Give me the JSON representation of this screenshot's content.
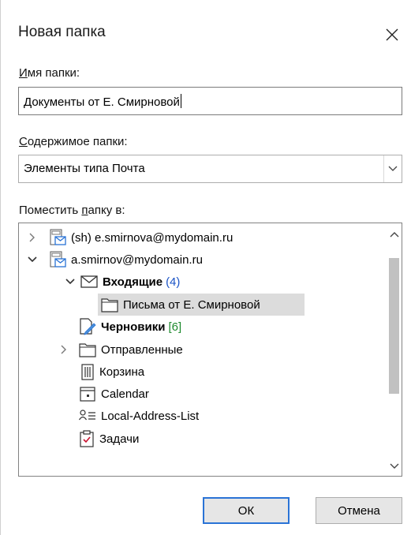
{
  "dialog": {
    "title": "Новая папка",
    "close_icon": "close-icon"
  },
  "folder_name": {
    "label_underlined": "И",
    "label_rest": "мя папки:",
    "value": "Документы от Е. Смирновой"
  },
  "folder_contents": {
    "label_underlined": "С",
    "label_rest": "одержимое папки:",
    "selected": "Элементы типа Почта"
  },
  "location": {
    "label_before": "Поместить ",
    "label_underlined": "п",
    "label_after": "апку в:"
  },
  "tree": {
    "items": [
      {
        "label": "(sh) e.smirnova@mydomain.ru",
        "icon": "mailbox-icon",
        "expander": "collapsed"
      },
      {
        "label": "a.smirnov@mydomain.ru",
        "icon": "mailbox-icon",
        "expander": "expanded"
      },
      {
        "label": "Входящие",
        "count": "(4)",
        "icon": "inbox-icon",
        "expander": "expanded"
      },
      {
        "label": "Письма от Е. Смирновой",
        "icon": "folder-icon",
        "selected": true
      },
      {
        "label": "Черновики",
        "count": "[6]",
        "icon": "drafts-icon"
      },
      {
        "label": "Отправленные",
        "icon": "folder-icon",
        "expander": "collapsed"
      },
      {
        "label": "Корзина",
        "icon": "trash-icon"
      },
      {
        "label": "Calendar",
        "icon": "calendar-icon"
      },
      {
        "label": "Local-Address-List",
        "icon": "contacts-icon"
      },
      {
        "label": "Задачи",
        "icon": "tasks-icon"
      }
    ]
  },
  "buttons": {
    "ok": "ОК",
    "cancel": "Отмена"
  },
  "colors": {
    "accent": "#2a73d6",
    "count_blue": "#1a53c6",
    "count_green": "#1e8a2e",
    "selection": "#dcdcdc"
  }
}
